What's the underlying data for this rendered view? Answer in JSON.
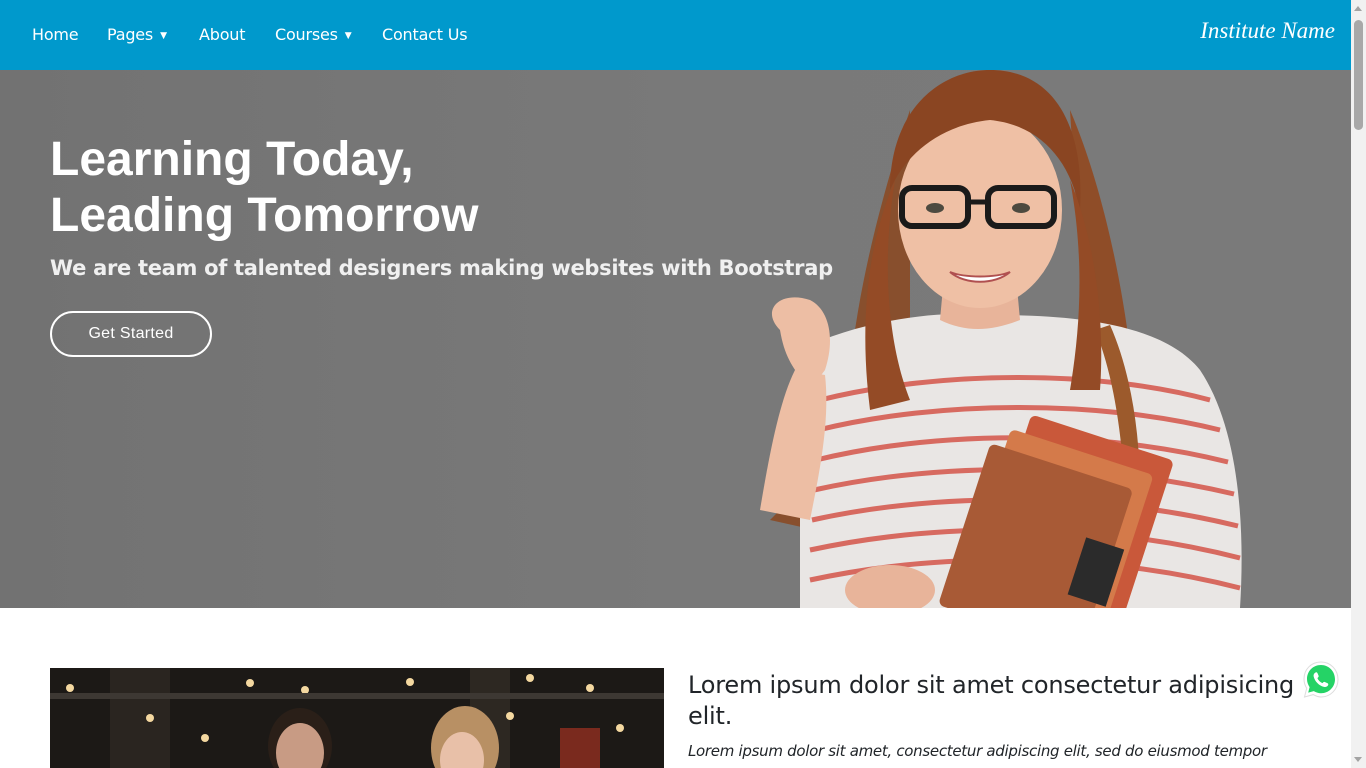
{
  "colors": {
    "navbar_bg": "#0099cc",
    "hero_overlay": "#777777",
    "whatsapp_green": "#25d366"
  },
  "navbar": {
    "items": [
      {
        "label": "Home",
        "icon": null
      },
      {
        "label": "Pages",
        "icon": "caret-down-icon"
      },
      {
        "label": "About",
        "icon": null
      },
      {
        "label": "Courses",
        "icon": "caret-down-icon"
      },
      {
        "label": "Contact Us",
        "icon": null
      }
    ],
    "brand": "Institute Name"
  },
  "hero": {
    "title_line1": "Learning Today,",
    "title_line2": "Leading Tomorrow",
    "subtitle": "We are team of talented designers making websites with Bootstrap",
    "button_label": "Get Started"
  },
  "about": {
    "heading": "Lorem ipsum dolor sit amet consectetur adipisicing elit.",
    "text": "Lorem ipsum dolor sit amet, consectetur adipiscing elit, sed do eiusmod tempor"
  },
  "floating": {
    "icon": "whatsapp-icon"
  }
}
